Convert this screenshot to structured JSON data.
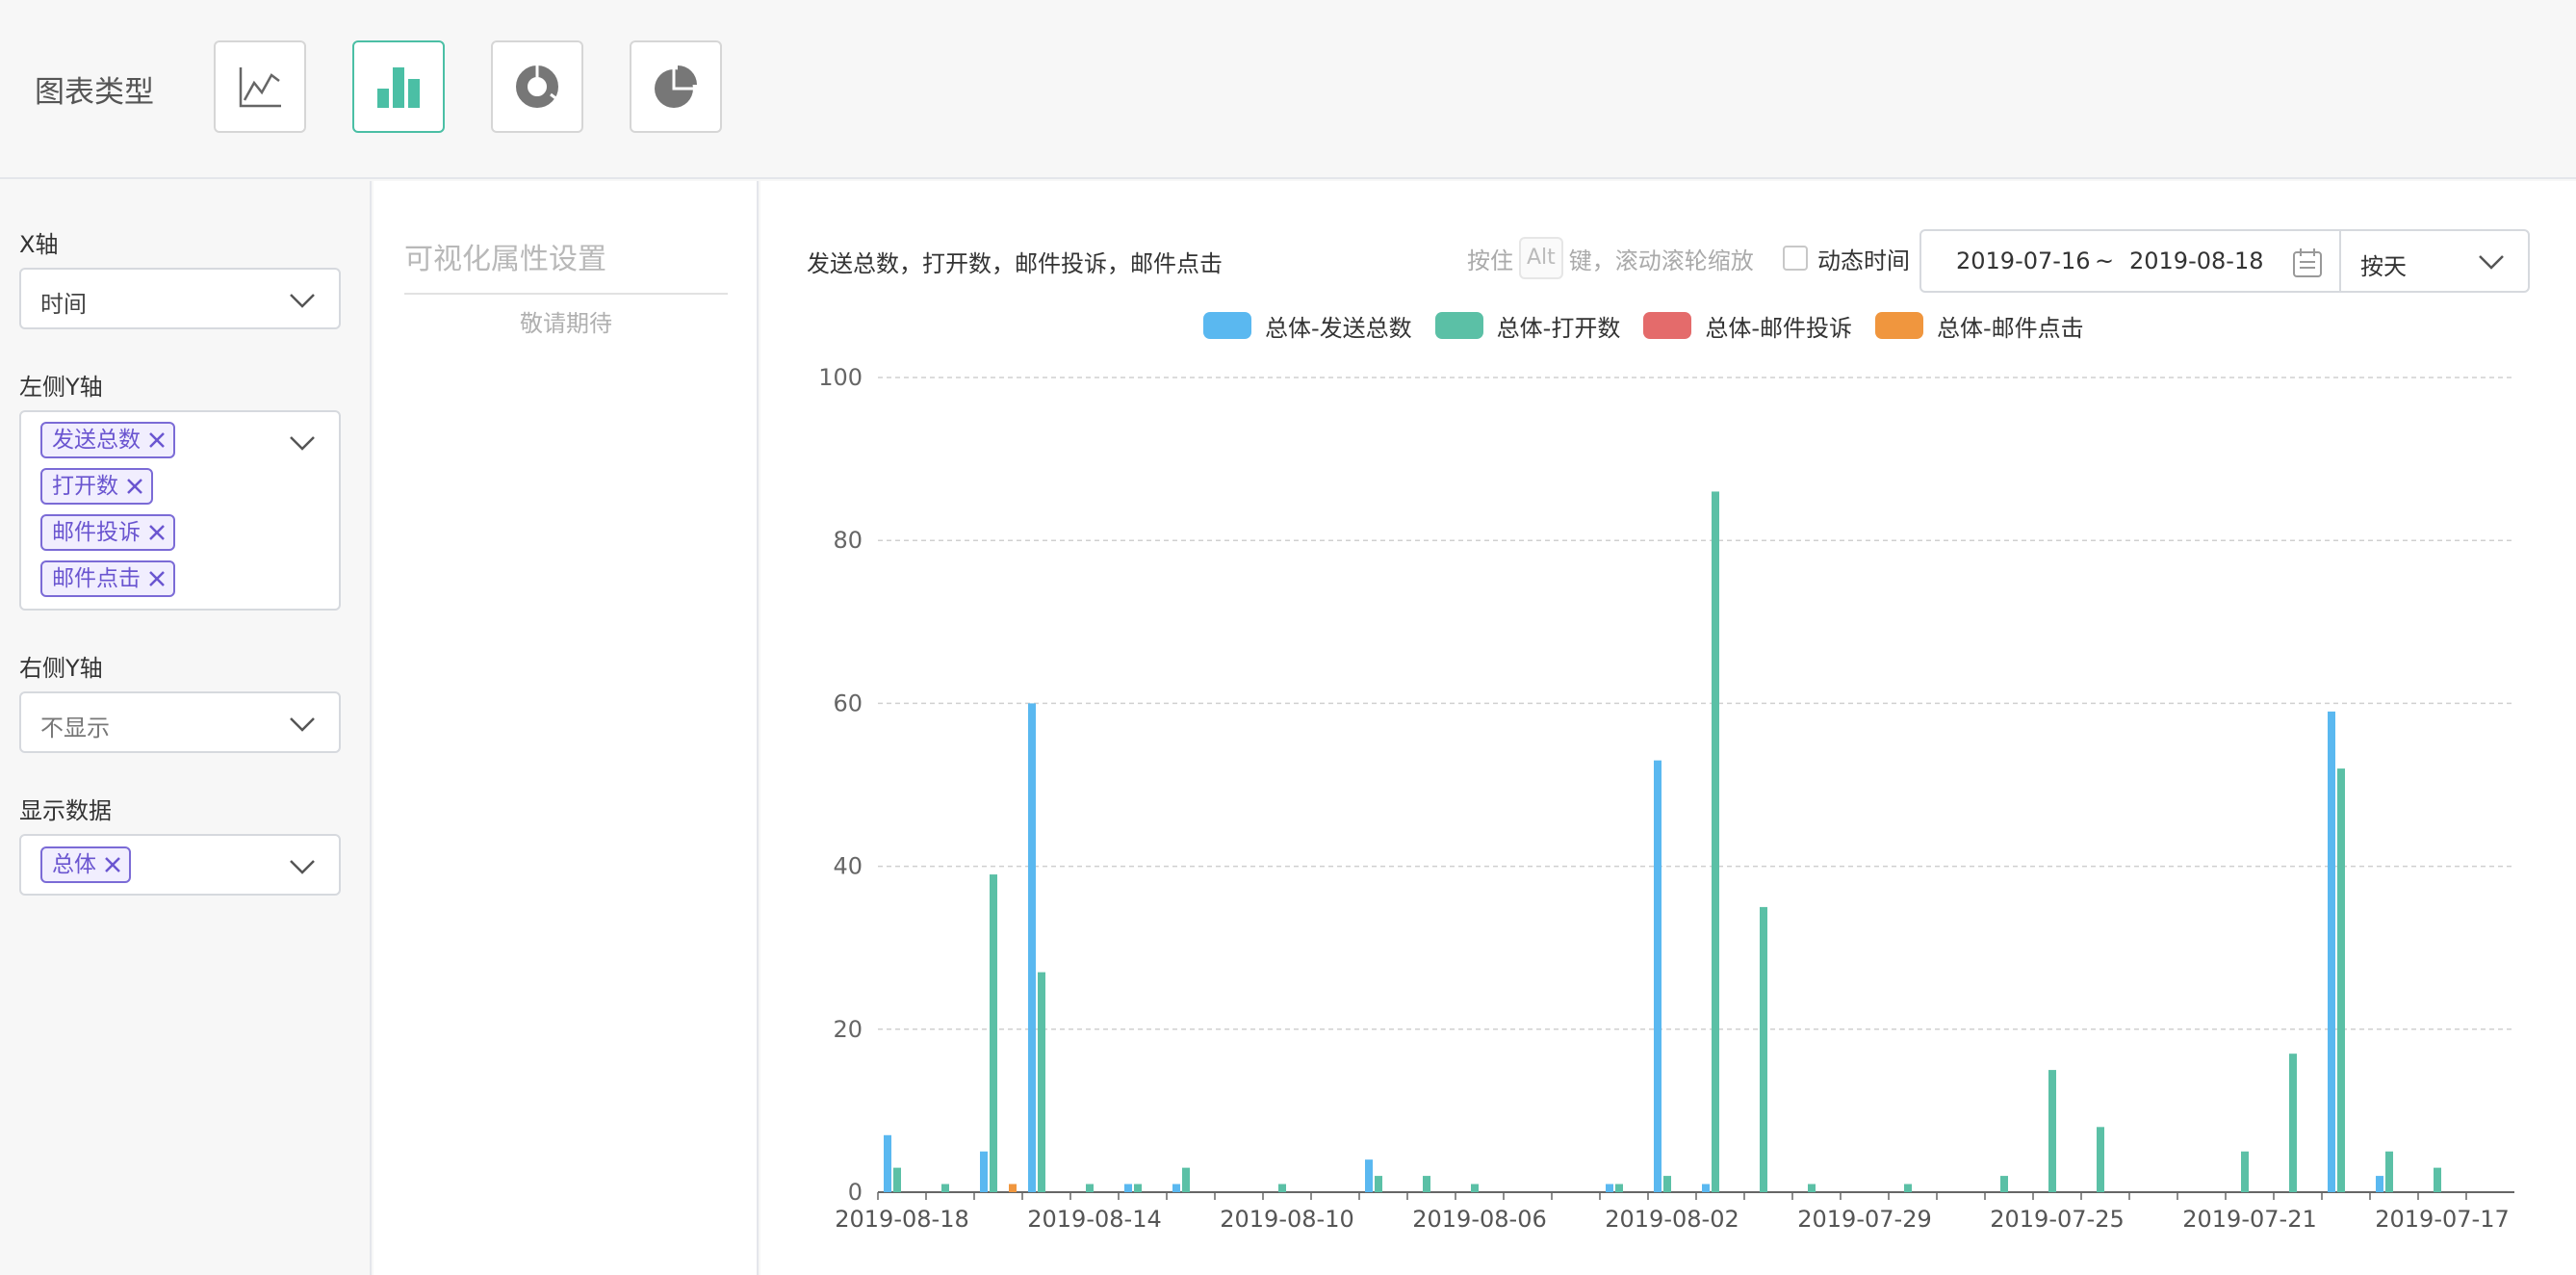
{
  "toolbar": {
    "chart_type_label": "图表类型",
    "types": [
      {
        "name": "line",
        "icon": "line-chart-icon",
        "active": false
      },
      {
        "name": "bar",
        "icon": "bar-chart-icon",
        "active": true
      },
      {
        "name": "donut",
        "icon": "donut-chart-icon",
        "active": false
      },
      {
        "name": "pie",
        "icon": "pie-chart-icon",
        "active": false
      }
    ]
  },
  "left_panel": {
    "x_axis_label": "X轴",
    "x_axis_value": "时间",
    "left_y_label": "左侧Y轴",
    "left_y_tags": [
      "发送总数",
      "打开数",
      "邮件投诉",
      "邮件点击"
    ],
    "right_y_label": "右侧Y轴",
    "right_y_value": "不显示",
    "show_data_label": "显示数据",
    "show_data_tags": [
      "总体"
    ]
  },
  "mid_panel": {
    "title": "可视化属性设置",
    "subtitle": "敬请期待"
  },
  "chart_header": {
    "title": "发送总数，打开数，邮件投诉，邮件点击",
    "hint_prefix": "按住",
    "hint_key": "Alt",
    "hint_suffix": "键，滚动滚轮缩放",
    "dynamic_time_label": "动态时间",
    "date_start": "2019-07-16",
    "date_sep": "~",
    "date_end": "2019-08-18",
    "granularity": "按天"
  },
  "colors": {
    "send_total": "#5ab8f0",
    "open": "#5bc0a6",
    "complaint": "#e46b6b",
    "click": "#f0963e",
    "accent": "#4bbfa5",
    "tag": "#6a55d0"
  },
  "chart_data": {
    "type": "bar",
    "title": "发送总数，打开数，邮件投诉，邮件点击",
    "xlabel": "",
    "ylabel": "",
    "ylim": [
      0,
      100
    ],
    "yticks": [
      0,
      20,
      40,
      60,
      80,
      100
    ],
    "grid": true,
    "legend_position": "top-center",
    "categories": [
      "2019-08-18",
      "2019-08-17",
      "2019-08-16",
      "2019-08-15",
      "2019-08-14",
      "2019-08-13",
      "2019-08-12",
      "2019-08-11",
      "2019-08-10",
      "2019-08-09",
      "2019-08-08",
      "2019-08-07",
      "2019-08-06",
      "2019-08-05",
      "2019-08-04",
      "2019-08-03",
      "2019-08-02",
      "2019-08-01",
      "2019-07-31",
      "2019-07-30",
      "2019-07-29",
      "2019-07-28",
      "2019-07-27",
      "2019-07-26",
      "2019-07-25",
      "2019-07-24",
      "2019-07-23",
      "2019-07-22",
      "2019-07-21",
      "2019-07-20",
      "2019-07-19",
      "2019-07-18",
      "2019-07-17",
      "2019-07-16"
    ],
    "tick_labels": [
      "2019-08-18",
      "2019-08-14",
      "2019-08-10",
      "2019-08-06",
      "2019-08-02",
      "2019-07-29",
      "2019-07-25",
      "2019-07-21",
      "2019-07-17"
    ],
    "series": [
      {
        "name": "总体-发送总数",
        "color": "#5ab8f0",
        "values": [
          7,
          0,
          5,
          60,
          0,
          1,
          1,
          0,
          0,
          0,
          4,
          0,
          0,
          0,
          0,
          1,
          53,
          1,
          0,
          0,
          0,
          0,
          0,
          0,
          0,
          0,
          0,
          0,
          0,
          0,
          59,
          2,
          0,
          0
        ]
      },
      {
        "name": "总体-打开数",
        "color": "#5bc0a6",
        "values": [
          3,
          1,
          39,
          27,
          1,
          1,
          3,
          0,
          1,
          0,
          2,
          2,
          1,
          0,
          0,
          1,
          2,
          86,
          35,
          1,
          0,
          1,
          0,
          2,
          15,
          8,
          0,
          0,
          5,
          17,
          52,
          5,
          3,
          0
        ]
      },
      {
        "name": "总体-邮件投诉",
        "color": "#e46b6b",
        "values": [
          0,
          0,
          0,
          0,
          0,
          0,
          0,
          0,
          0,
          0,
          0,
          0,
          0,
          0,
          0,
          0,
          0,
          0,
          0,
          0,
          0,
          0,
          0,
          0,
          0,
          0,
          0,
          0,
          0,
          0,
          0,
          0,
          0,
          0
        ]
      },
      {
        "name": "总体-邮件点击",
        "color": "#f0963e",
        "values": [
          0,
          0,
          1,
          0,
          0,
          0,
          0,
          0,
          0,
          0,
          0,
          0,
          0,
          0,
          0,
          0,
          0,
          0,
          0,
          0,
          0,
          0,
          0,
          0,
          0,
          0,
          0,
          0,
          0,
          0,
          0,
          0,
          0,
          0
        ]
      }
    ]
  }
}
